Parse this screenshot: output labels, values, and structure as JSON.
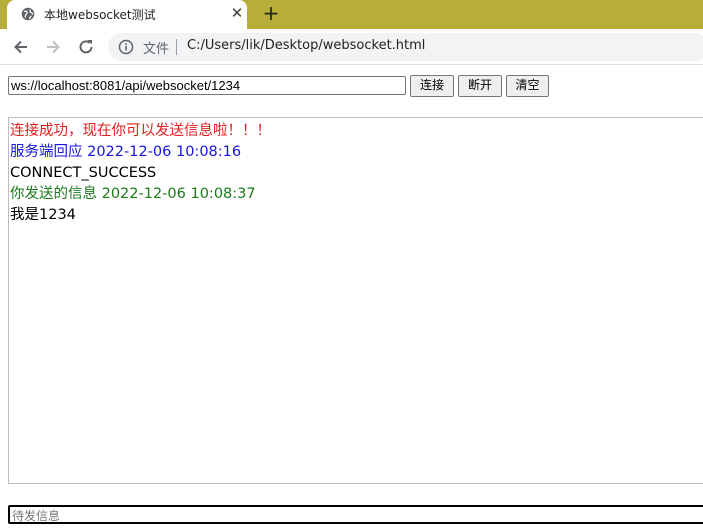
{
  "browser": {
    "tab_title": "本地websocket测试",
    "tab_close": "✕",
    "new_tab": "+",
    "scheme_label": "文件",
    "address": "C:/Users/lik/Desktop/websocket.html"
  },
  "controls": {
    "ws_url_value": "ws://localhost:8081/api/websocket/1234",
    "connect_label": "连接",
    "disconnect_label": "断开",
    "clear_label": "清空"
  },
  "log": {
    "lines": [
      {
        "text": "连接成功，现在你可以发送信息啦！！！",
        "color": "#e02020"
      },
      {
        "text": "服务端回应 2022-12-06 10:08:16",
        "color": "#1515e0"
      },
      {
        "text": "CONNECT_SUCCESS",
        "color": "#000000"
      },
      {
        "text": "你发送的信息 2022-12-06 10:08:37",
        "color": "#1a7a1a"
      },
      {
        "text": "我是1234",
        "color": "#000000"
      }
    ]
  },
  "message": {
    "placeholder": "待发信息"
  },
  "colors": {
    "tab_strip": "#b6ae38"
  }
}
